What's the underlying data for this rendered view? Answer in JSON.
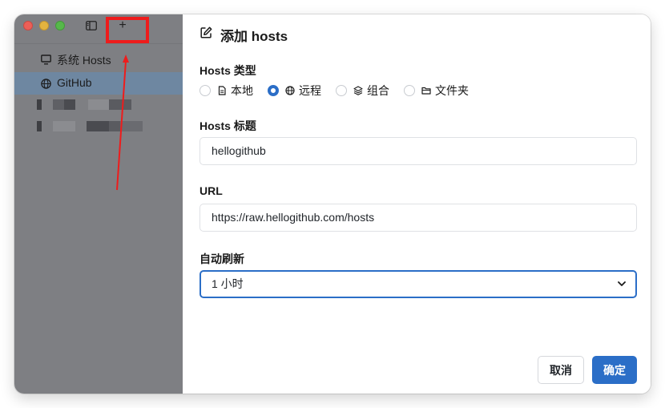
{
  "sidebar": {
    "add_symbol": "+",
    "items": [
      {
        "label": "系统 Hosts",
        "icon": "monitor-icon"
      },
      {
        "label": "GitHub",
        "icon": "globe-icon",
        "selected": true
      }
    ]
  },
  "form": {
    "title": "添加 hosts",
    "type_label": "Hosts 类型",
    "type_options": [
      {
        "label": "本地",
        "icon": "file-icon"
      },
      {
        "label": "远程",
        "icon": "globe-icon",
        "selected": true
      },
      {
        "label": "组合",
        "icon": "layers-icon"
      },
      {
        "label": "文件夹",
        "icon": "folder-icon"
      }
    ],
    "title_label": "Hosts 标题",
    "title_value": "hellogithub",
    "url_label": "URL",
    "url_value": "https://raw.hellogithub.com/hosts",
    "refresh_label": "自动刷新",
    "refresh_value": "1 小时",
    "cancel_label": "取消",
    "confirm_label": "确定"
  },
  "colors": {
    "accent": "#2b6ec7",
    "annotation": "#ee1c1c",
    "sidebar_bg": "#7e7f83"
  }
}
